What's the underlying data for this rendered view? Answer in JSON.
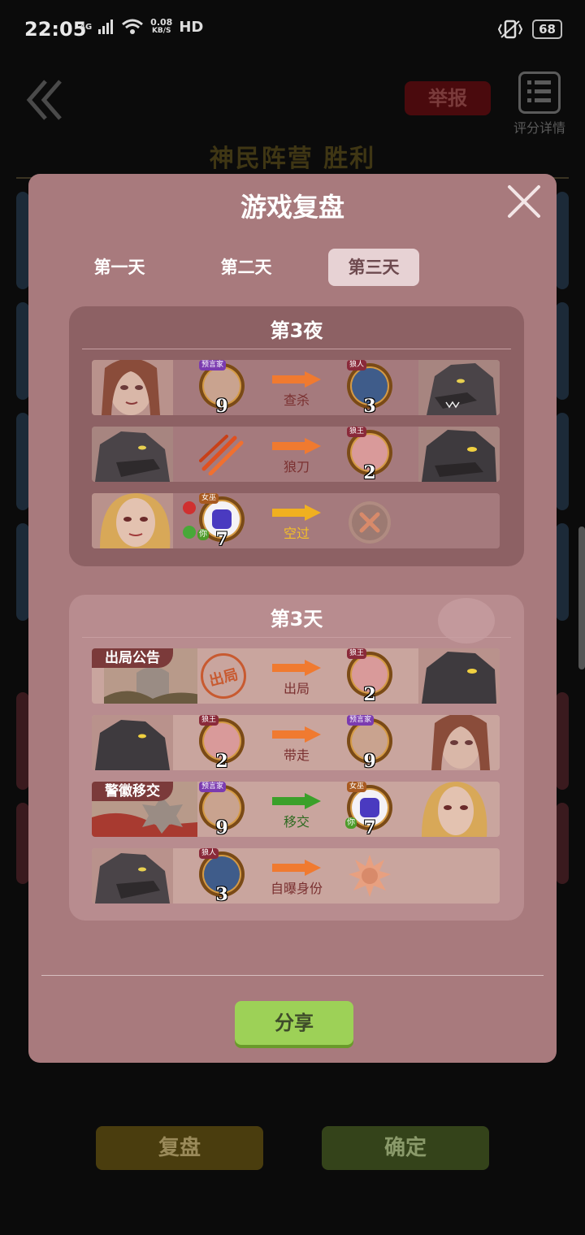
{
  "status_bar": {
    "time": "22:05",
    "network": "4G",
    "speed_value": "0.08",
    "speed_unit": "KB/S",
    "hd": "HD",
    "battery": "68"
  },
  "background": {
    "report_label": "举报",
    "score_detail_label": "评分详情",
    "camp_result": "神民阵营  胜利",
    "replay_button": "复盘",
    "confirm_button": "确定"
  },
  "modal": {
    "title": "游戏复盘",
    "tabs": [
      "第一天",
      "第二天",
      "第三天"
    ],
    "active_tab": "第三天",
    "night_section": {
      "title": "第3夜",
      "rows": [
        {
          "left_badge": "预言家",
          "left_number": "9",
          "action": "查杀",
          "right_badge": "狼人",
          "right_number": "3"
        },
        {
          "action": "狼刀",
          "right_badge": "狼王",
          "right_number": "2"
        },
        {
          "left_badge": "女巫",
          "left_number": "7",
          "left_you": "你",
          "action": "空过"
        }
      ]
    },
    "day_section": {
      "title": "第3天",
      "rows": [
        {
          "tag": "出局公告",
          "stamp": "出局",
          "action": "出局",
          "right_badge": "狼王",
          "right_number": "2"
        },
        {
          "left_badge": "狼王",
          "left_number": "2",
          "action": "带走",
          "right_badge": "预言家",
          "right_number": "9"
        },
        {
          "tag": "警徽移交",
          "left_badge": "预言家",
          "left_number": "9",
          "action": "移交",
          "right_badge": "女巫",
          "right_number": "7",
          "right_you": "你"
        },
        {
          "left_badge": "狼人",
          "left_number": "3",
          "action": "自曝身份"
        }
      ]
    },
    "share_button": "分享"
  },
  "colors": {
    "modal_bg": "#a87a7d",
    "orange_arrow": "#f07a30",
    "yellow_arrow": "#f0b020",
    "green_arrow": "#3aa02a",
    "share_green": "#9dd157"
  }
}
